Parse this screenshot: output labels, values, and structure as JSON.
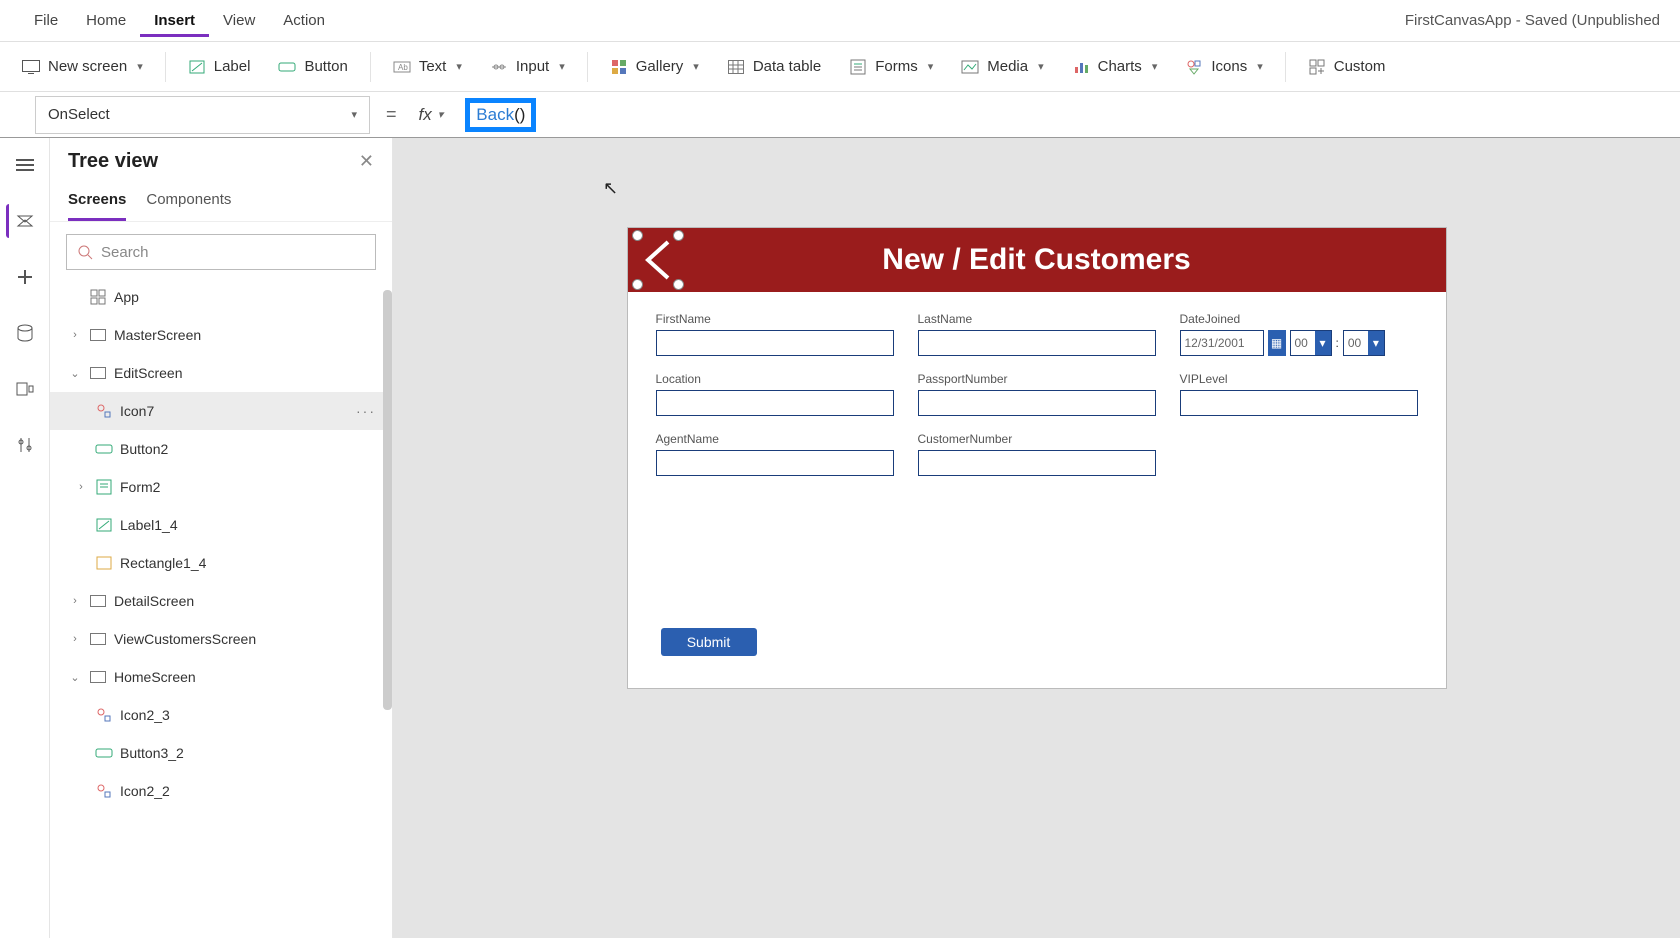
{
  "app": {
    "title": "FirstCanvasApp - Saved (Unpublished"
  },
  "menubar": {
    "file": "File",
    "home": "Home",
    "insert": "Insert",
    "view": "View",
    "action": "Action"
  },
  "ribbon": {
    "new_screen": "New screen",
    "label": "Label",
    "button": "Button",
    "text": "Text",
    "input": "Input",
    "gallery": "Gallery",
    "data_table": "Data table",
    "forms": "Forms",
    "media": "Media",
    "charts": "Charts",
    "icons": "Icons",
    "custom": "Custom"
  },
  "formula": {
    "property": "OnSelect",
    "eq": "=",
    "fx": "fx",
    "fn": "Back",
    "parens": "()"
  },
  "tree": {
    "title": "Tree view",
    "tabs": {
      "screens": "Screens",
      "components": "Components"
    },
    "search_placeholder": "Search",
    "app": "App",
    "nodes": {
      "master": "MasterScreen",
      "edit": "EditScreen",
      "icon7": "Icon7",
      "button2": "Button2",
      "form2": "Form2",
      "label1_4": "Label1_4",
      "rect1_4": "Rectangle1_4",
      "detail": "DetailScreen",
      "viewcust": "ViewCustomersScreen",
      "home": "HomeScreen",
      "icon2_3": "Icon2_3",
      "button3_2": "Button3_2",
      "icon2_2": "Icon2_2"
    },
    "more": "···"
  },
  "canvas": {
    "header_title": "New / Edit Customers",
    "fields": {
      "firstname": "FirstName",
      "lastname": "LastName",
      "datejoined": "DateJoined",
      "location": "Location",
      "passport": "PassportNumber",
      "vip": "VIPLevel",
      "agent": "AgentName",
      "custnum": "CustomerNumber"
    },
    "date_value": "12/31/2001",
    "hh": "00",
    "mm": "00",
    "colon": ":",
    "submit": "Submit"
  }
}
